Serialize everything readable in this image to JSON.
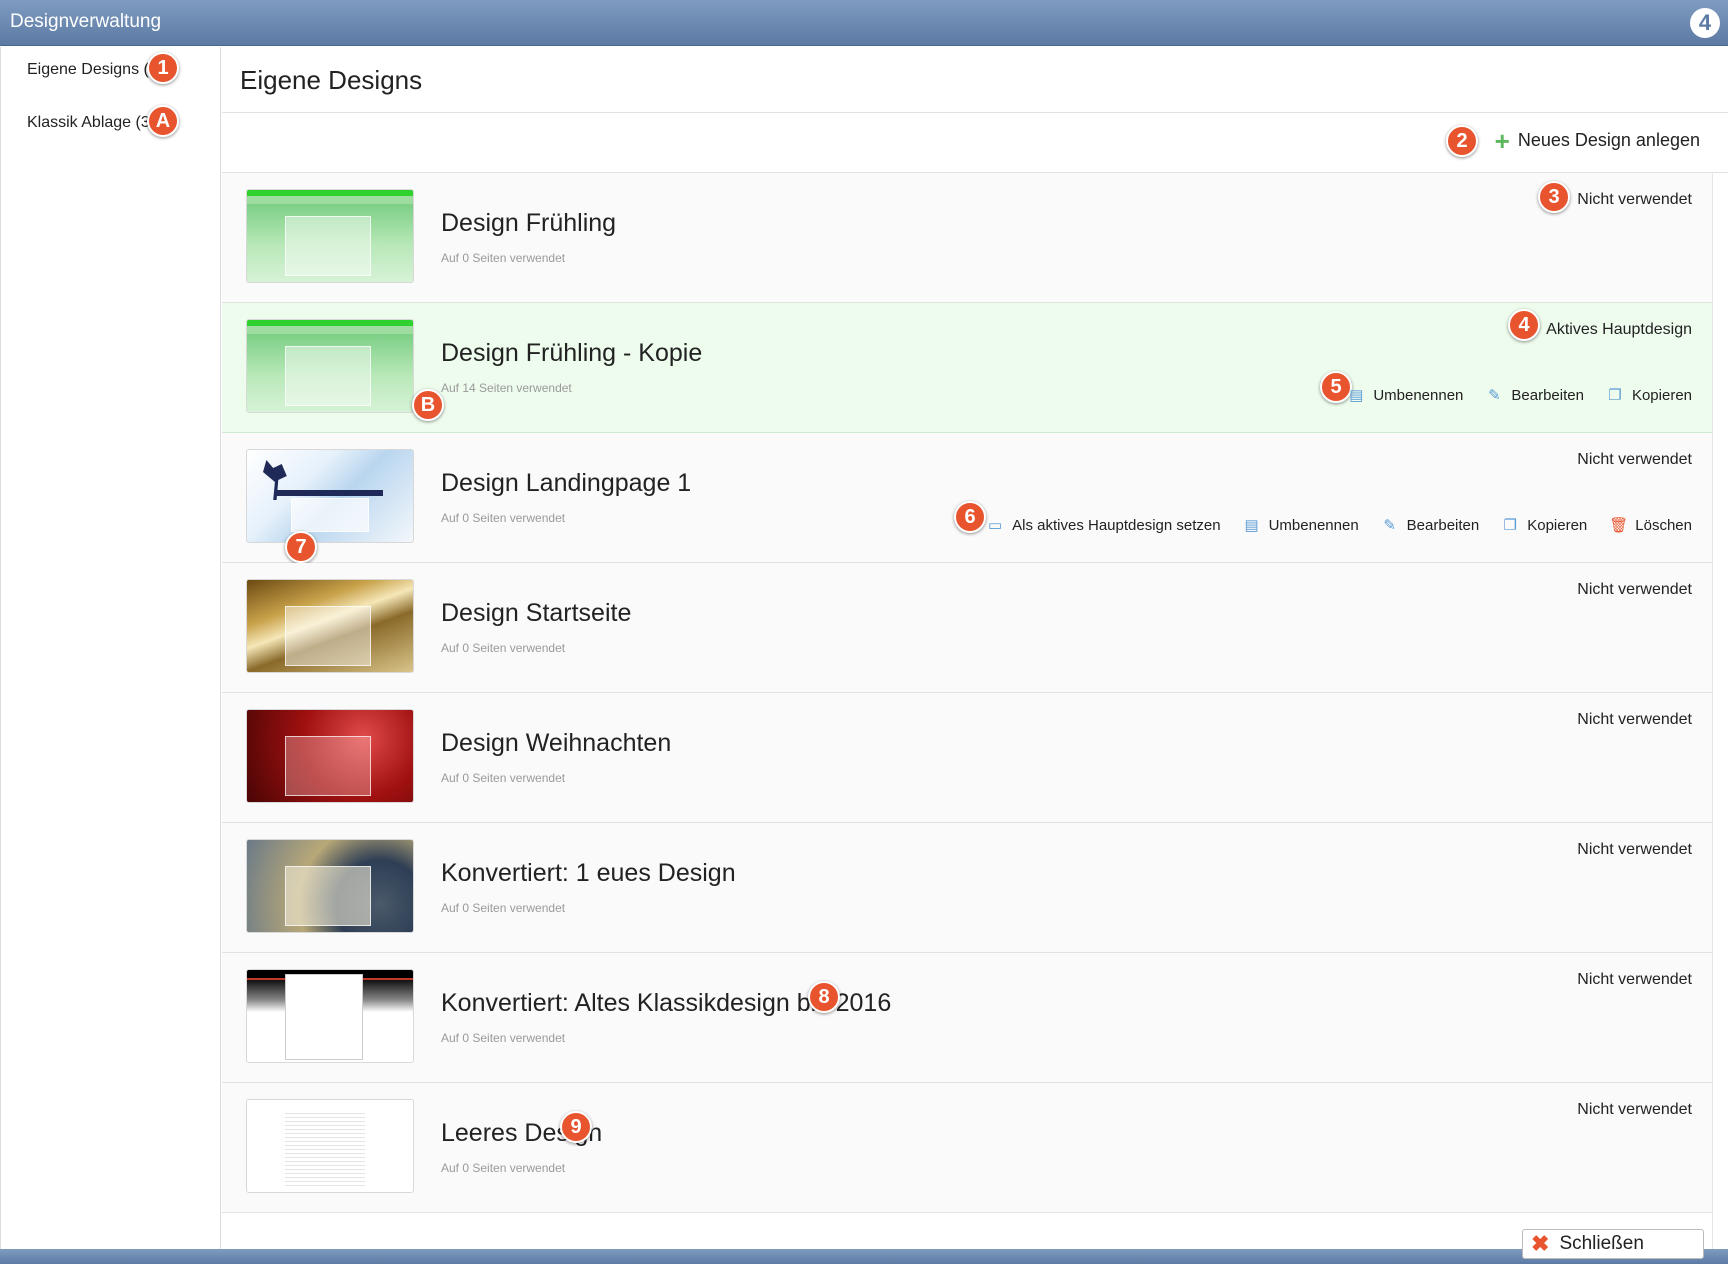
{
  "window": {
    "title": "Designverwaltung",
    "logo": "4"
  },
  "sidebar": {
    "items": [
      {
        "label": "Eigene Designs (8)",
        "marker": "1"
      },
      {
        "label": "Klassik Ablage (3)",
        "marker": "A"
      }
    ]
  },
  "main": {
    "title": "Eigene Designs",
    "new_design_label": "Neues Design anlegen",
    "new_design_marker": "2"
  },
  "designs": [
    {
      "name": "Design Frühling",
      "usage": "Auf 0 Seiten verwendet",
      "status": "Nicht verwendet",
      "thumb": "spring",
      "status_marker": "3"
    },
    {
      "name": "Design Frühling - Kopie",
      "usage": "Auf 14 Seiten verwendet",
      "status": "Aktives Hauptdesign",
      "thumb": "spring",
      "status_marker": "4",
      "usage_marker": "B",
      "actions_marker": "5",
      "actions": [
        {
          "label": "Umbenennen",
          "icon": "rename-icon"
        },
        {
          "label": "Bearbeiten",
          "icon": "pencil-icon"
        },
        {
          "label": "Kopieren",
          "icon": "copy-icon"
        }
      ]
    },
    {
      "name": "Design Landingpage 1",
      "usage": "Auf 0 Seiten verwendet",
      "status": "Nicht verwendet",
      "thumb": "dancer",
      "thumb_marker": "7",
      "actions_marker": "6",
      "actions": [
        {
          "label": "Als aktives Hauptdesign setzen",
          "icon": "window-icon"
        },
        {
          "label": "Umbenennen",
          "icon": "rename-icon"
        },
        {
          "label": "Bearbeiten",
          "icon": "pencil-icon"
        },
        {
          "label": "Kopieren",
          "icon": "copy-icon"
        },
        {
          "label": "Löschen",
          "icon": "trash-icon"
        }
      ]
    },
    {
      "name": "Design Startseite",
      "usage": "Auf 0 Seiten verwendet",
      "status": "Nicht verwendet",
      "thumb": "gold"
    },
    {
      "name": "Design Weihnachten",
      "usage": "Auf 0 Seiten verwendet",
      "status": "Nicht verwendet",
      "thumb": "christmas"
    },
    {
      "name": "Konvertiert: 1 eues Design",
      "usage": "Auf 0 Seiten verwendet",
      "status": "Nicht verwendet",
      "thumb": "clock"
    },
    {
      "name": "Konvertiert: Altes Klassikdesign bis 2016",
      "usage": "Auf 0 Seiten verwendet",
      "status": "Nicht verwendet",
      "thumb": "classic",
      "name_marker": "8"
    },
    {
      "name": "Leeres Design",
      "usage": "Auf 0 Seiten verwendet",
      "status": "Nicht verwendet",
      "thumb": "blank",
      "name_marker": "9"
    }
  ],
  "footer": {
    "close_label": "Schließen"
  }
}
